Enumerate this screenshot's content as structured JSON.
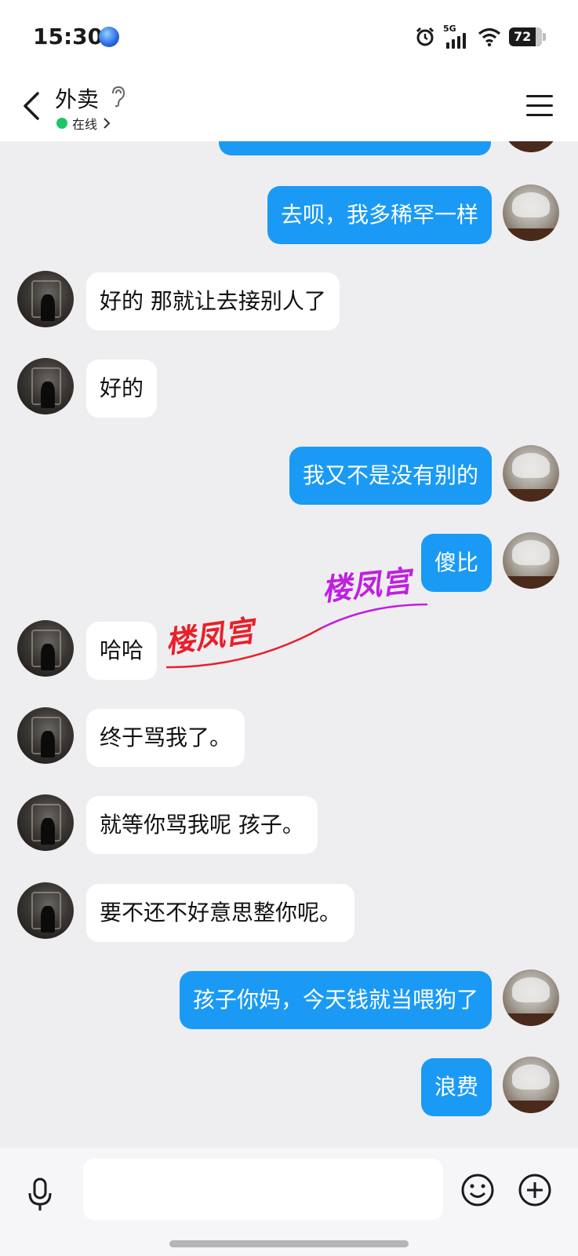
{
  "status_bar": {
    "time": "15:30",
    "network": "5G",
    "battery": "72",
    "icons": [
      "globe-icon",
      "alarm-icon",
      "signal-icon",
      "wifi-icon",
      "battery-icon"
    ]
  },
  "header": {
    "title": "外卖",
    "status": "在线",
    "status_color": "#20c466",
    "icons": [
      "back-icon",
      "ear-icon",
      "menu-icon"
    ]
  },
  "messages": [
    {
      "side": "out",
      "text": ""
    },
    {
      "side": "out",
      "text": "去呗，我多稀罕一样"
    },
    {
      "side": "in",
      "text": "好的 那就让去接别人了"
    },
    {
      "side": "in",
      "text": "好的"
    },
    {
      "side": "out",
      "text": "我又不是没有别的"
    },
    {
      "side": "out",
      "text": "傻比"
    },
    {
      "side": "in",
      "text": "哈哈"
    },
    {
      "side": "in",
      "text": "终于骂我了。"
    },
    {
      "side": "in",
      "text": "就等你骂我呢 孩子。"
    },
    {
      "side": "in",
      "text": "要不还不好意思整你呢。"
    },
    {
      "side": "out",
      "text": "孩子你妈，今天钱就当喂狗了"
    },
    {
      "side": "out",
      "text": "浪费"
    }
  ],
  "watermark": {
    "text_red": "楼凤宫",
    "text_purple": "楼凤宫",
    "red": "#e8202a",
    "purple": "#c020e0"
  },
  "colors": {
    "outgoing_bubble": "#1a9af5",
    "incoming_bubble": "#ffffff",
    "background": "#eeeef1"
  },
  "input_bar": {
    "icons": [
      "mic-icon",
      "emoji-icon",
      "plus-icon"
    ]
  }
}
